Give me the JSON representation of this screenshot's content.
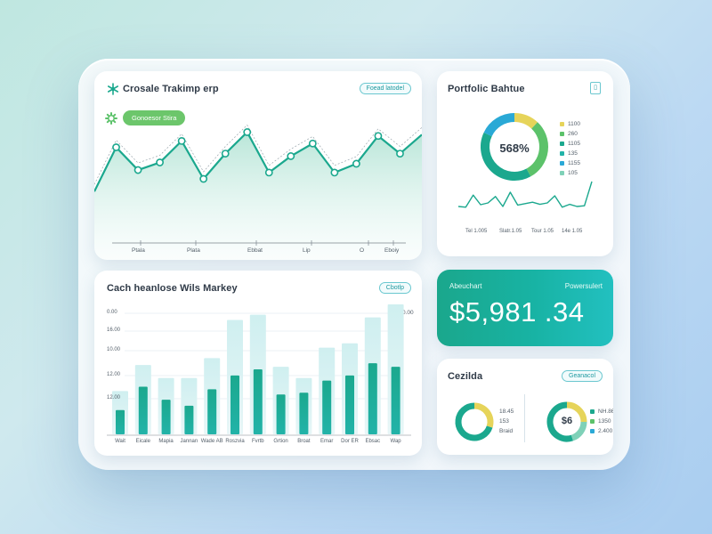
{
  "colors": {
    "accent": "#1ba88e",
    "accent_light": "#7fd1b8",
    "teal": "#22b3a8",
    "green": "#5cc26a",
    "yellow": "#e6d45a",
    "blue": "#2aa9d6"
  },
  "line_card": {
    "title": "Crosale Trakimp erp",
    "pill": "Foead latodel",
    "badge": "Gonoesor Stira",
    "x_ticks": [
      "Ptala",
      "Plata",
      "Ebbat",
      "Lip",
      "O",
      "Eboiy"
    ]
  },
  "line_chart_data": {
    "type": "line",
    "values": [
      40,
      75,
      57,
      63,
      80,
      50,
      70,
      87,
      55,
      68,
      78,
      55,
      62,
      84,
      70,
      85
    ]
  },
  "portfolio_card": {
    "title": "Portfolic Bahtue",
    "center_label": "568%",
    "legend": [
      {
        "label": "1100",
        "color": "#e6d45a"
      },
      {
        "label": "260",
        "color": "#5cc26a"
      },
      {
        "label": "1105",
        "color": "#1ba88e"
      },
      {
        "label": "135",
        "color": "#22b3a8"
      },
      {
        "label": "1155",
        "color": "#2aa9d6"
      },
      {
        "label": "105",
        "color": "#7fd1b8"
      }
    ],
    "x_ticks": [
      "Tel 1.005",
      "Slatr.1.05",
      "Tour 1.05",
      "14e 1.05"
    ]
  },
  "portfolio_chart_data": {
    "type": "pie",
    "values": [
      12,
      30,
      40,
      18
    ],
    "colors": [
      "#e6d45a",
      "#5cc26a",
      "#1ba88e",
      "#2aa9d6"
    ]
  },
  "portfolio_spark_data": {
    "type": "line",
    "values": [
      30,
      28,
      62,
      35,
      40,
      58,
      30,
      70,
      34,
      38,
      42,
      36,
      40,
      60,
      28,
      36,
      30,
      32,
      100
    ]
  },
  "bar_card": {
    "title": "Cach heanlose Wils Markey",
    "pill": "Cbotlp",
    "y_ticks": [
      "0.00",
      "16.00",
      "10.00",
      "12.00",
      "12.00"
    ],
    "right_tick": "0.00",
    "x_ticks": [
      "Wait",
      "Eicale",
      "Mapia",
      "Jannan",
      "Wade AB",
      "Roszvia",
      "Fvrtb",
      "Grtion",
      "Broat",
      "Emar",
      "Dor ER",
      "Ebsac",
      "Wap"
    ]
  },
  "bar_chart_data": {
    "type": "bar",
    "categories": [
      "Wait",
      "Eicale",
      "Mapia",
      "Jannan",
      "Wade AB",
      "Roszvia",
      "Fvrtb",
      "Grtion",
      "Broat",
      "Emar",
      "Dor ER",
      "Ebsac",
      "Wap"
    ],
    "series": [
      {
        "values": [
          28,
          55,
          40,
          33,
          52,
          68,
          75,
          46,
          48,
          62,
          68,
          82,
          78
        ]
      },
      {
        "values": [
          50,
          80,
          65,
          65,
          88,
          132,
          138,
          78,
          65,
          100,
          105,
          135,
          150
        ]
      }
    ]
  },
  "balance_card": {
    "label": "Abeuchart",
    "label_right": "Powersulert",
    "amount": "$5,981 .34"
  },
  "bottom_card": {
    "title": "Cezilda",
    "pill": "Geanacol",
    "left_legend": [
      "18.45",
      "153",
      "Braid"
    ],
    "right_center": "$6",
    "right_legend": [
      "NH.86",
      "1350",
      "2.400"
    ]
  },
  "donut_left_data": {
    "type": "pie",
    "values": [
      30,
      70
    ],
    "colors": [
      "#e6d45a",
      "#1ba88e"
    ]
  },
  "donut_right_data": {
    "type": "pie",
    "values": [
      25,
      20,
      55
    ],
    "colors": [
      "#e6d45a",
      "#7fd1b8",
      "#1ba88e"
    ]
  }
}
